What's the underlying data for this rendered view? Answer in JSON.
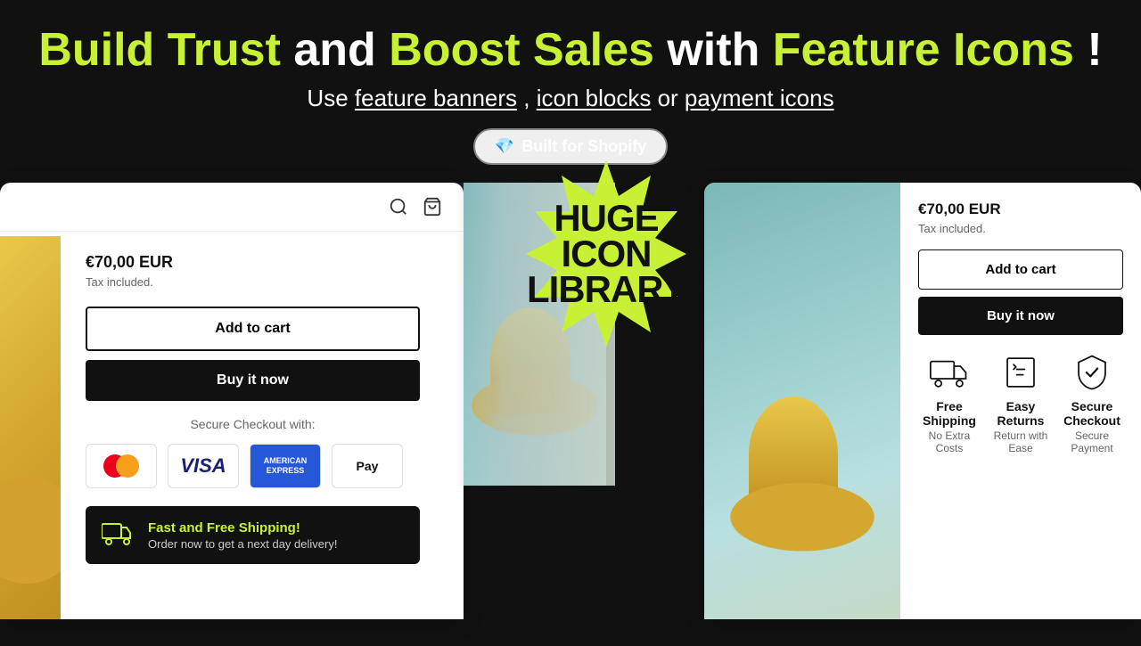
{
  "header": {
    "title_part1": "Build Trust",
    "title_and": " and ",
    "title_part2": "Boost Sales",
    "title_with": " with ",
    "title_part3": "Feature Icons",
    "title_exclaim": "!",
    "subtitle_use": "Use ",
    "subtitle_feature": "feature banners",
    "subtitle_comma1": ", ",
    "subtitle_icon": "icon blocks",
    "subtitle_or": " or ",
    "subtitle_payment": "payment icons",
    "shopify_badge": "Built for Shopify",
    "shopify_emoji": "💎"
  },
  "starburst": {
    "line1": "HUGE",
    "line2": "ICON",
    "line3": "LIBRARY"
  },
  "left_card": {
    "price": "€70,00 EUR",
    "tax": "Tax included.",
    "add_to_cart": "Add to cart",
    "buy_now": "Buy it now",
    "secure_label": "Secure Checkout with:",
    "payment_icons": [
      "Mastercard",
      "VISA",
      "American Express",
      "Apple Pay"
    ],
    "shipping_title": "Fast and Free Shipping!",
    "shipping_sub": "Order now to get a next day delivery!"
  },
  "right_card": {
    "price": "€70,00 EUR",
    "tax": "Tax included.",
    "add_to_cart": "Add to cart",
    "buy_now": "Buy it now",
    "features": [
      {
        "id": "shipping",
        "title": "Free Shipping",
        "sub": "No Extra Costs"
      },
      {
        "id": "returns",
        "title": "Easy Returns",
        "sub": "Return with Ease"
      },
      {
        "id": "checkout",
        "title": "Secure Checkout",
        "sub": "Secure Payment"
      }
    ]
  },
  "colors": {
    "green": "#c8f135",
    "dark": "#111111",
    "white": "#ffffff"
  }
}
